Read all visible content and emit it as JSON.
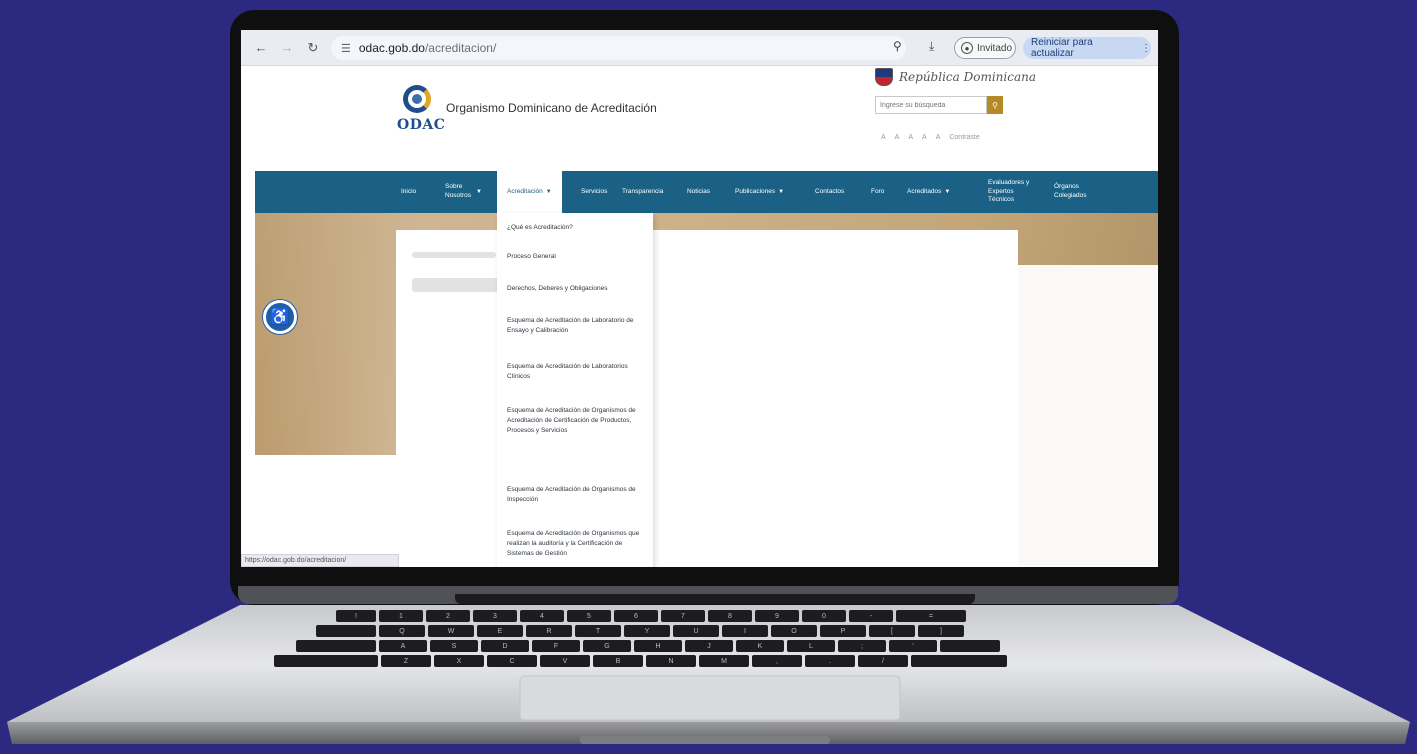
{
  "browser": {
    "url_host": "odac.gob.do",
    "url_path": "/acreditacion/",
    "guest_label": "Invitado",
    "update_label": "Reiniciar para actualizar",
    "status_url": "https://odac.gob.do/acreditacion/"
  },
  "site": {
    "org_name": "Organismo Dominicano de Acreditación",
    "logo_text": "ODAC",
    "gov_text": "República Dominicana",
    "search_placeholder": "Ingrese su búsqueda",
    "a11y_controls": [
      "A",
      "A",
      "A",
      "A",
      "A",
      "Contraste"
    ]
  },
  "nav": {
    "items": [
      {
        "label": "Inicio"
      },
      {
        "label": "Sobre Nosotros"
      },
      {
        "label": "Acreditación"
      },
      {
        "label": "Servicios"
      },
      {
        "label": "Transparencia"
      },
      {
        "label": "Noticias"
      },
      {
        "label": "Publicaciones"
      },
      {
        "label": "Contactos"
      },
      {
        "label": "Foro"
      },
      {
        "label": "Acreditados"
      },
      {
        "label": "Evaluadores y Expertos Técnicos"
      },
      {
        "label": "Órganos Colegiados"
      }
    ]
  },
  "dropdown": {
    "items": [
      {
        "label": "¿Qué es Acreditación?"
      },
      {
        "label": "Proceso General"
      },
      {
        "label": "Derechos, Deberes y Obligaciones"
      },
      {
        "label": "Esquema de Acreditación de Laboratorio de Ensayo y Calibración"
      },
      {
        "label": "Esquema de Acreditación de Laboratorios Clínicos"
      },
      {
        "label": "Esquema de Acreditación de Organismos de Acreditación de Certificación de Productos, Procesos y Servicios"
      },
      {
        "label": "Esquema de Acreditación de Organismos de Inspección"
      },
      {
        "label": "Esquema de Acreditación de Organismos que realizan la auditoría y la Certificación de Sistemas de Gestión"
      }
    ]
  },
  "keyboard": {
    "row1": [
      "!",
      "1",
      "2",
      "3",
      "4",
      "5",
      "6",
      "7",
      "8",
      "9",
      "0",
      "-",
      "="
    ],
    "row2": [
      "Q",
      "W",
      "E",
      "R",
      "T",
      "Y",
      "U",
      "I",
      "O",
      "P",
      "[",
      "]"
    ],
    "row3": [
      "A",
      "S",
      "D",
      "F",
      "G",
      "H",
      "J",
      "K",
      "L",
      ";",
      "'"
    ],
    "row4": [
      "Z",
      "X",
      "C",
      "V",
      "B",
      "N",
      "M",
      ",",
      ".",
      "/"
    ]
  },
  "colors": {
    "background": "#2b2a80",
    "nav": "#1b6186",
    "accent_gold": "#b38a26",
    "a11y_button": "#1e5fa8"
  }
}
